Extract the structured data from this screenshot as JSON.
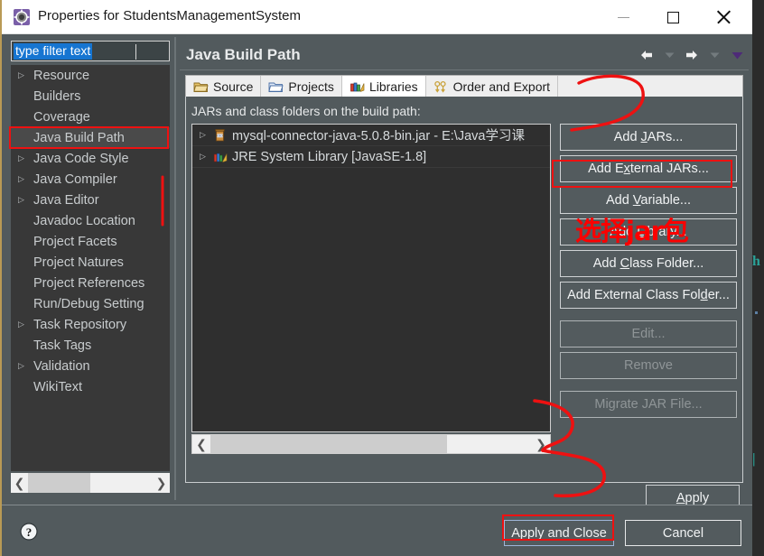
{
  "window": {
    "title": "Properties for StudentsManagementSystem",
    "app_icon": "eclipse-gear-icon",
    "minimize_label": "Minimize",
    "maximize_label": "Maximize",
    "close_label": "Close"
  },
  "filter": {
    "value": "type filter text",
    "placeholder": "type filter text"
  },
  "sidebar": {
    "items": [
      {
        "label": "Resource",
        "expandable": true,
        "selected": false
      },
      {
        "label": "Builders",
        "expandable": false,
        "selected": false
      },
      {
        "label": "Coverage",
        "expandable": false,
        "selected": false
      },
      {
        "label": "Java Build Path",
        "expandable": false,
        "selected": true
      },
      {
        "label": "Java Code Style",
        "expandable": true,
        "selected": false
      },
      {
        "label": "Java Compiler",
        "expandable": true,
        "selected": false
      },
      {
        "label": "Java Editor",
        "expandable": true,
        "selected": false
      },
      {
        "label": "Javadoc Location",
        "expandable": false,
        "selected": false
      },
      {
        "label": "Project Facets",
        "expandable": false,
        "selected": false
      },
      {
        "label": "Project Natures",
        "expandable": false,
        "selected": false
      },
      {
        "label": "Project References",
        "expandable": false,
        "selected": false
      },
      {
        "label": "Run/Debug Setting",
        "expandable": false,
        "selected": false
      },
      {
        "label": "Task Repository",
        "expandable": true,
        "selected": false
      },
      {
        "label": "Task Tags",
        "expandable": false,
        "selected": false
      },
      {
        "label": "Validation",
        "expandable": true,
        "selected": false
      },
      {
        "label": "WikiText",
        "expandable": false,
        "selected": false
      }
    ],
    "scroll_left_icon": "chevron-left-icon",
    "scroll_right_icon": "chevron-right-icon"
  },
  "page": {
    "title": "Java Build Path",
    "nav": {
      "back_icon": "arrow-left-icon",
      "back_menu_icon": "chevron-down-icon",
      "forward_icon": "arrow-right-icon",
      "forward_menu_icon": "chevron-down-icon",
      "view_menu_icon": "triangle-down-icon"
    }
  },
  "tabs": [
    {
      "label": "Source",
      "icon": "source-folder-icon",
      "active": false
    },
    {
      "label": "Projects",
      "icon": "project-folder-icon",
      "active": false
    },
    {
      "label": "Libraries",
      "icon": "books-icon",
      "active": true
    },
    {
      "label": "Order and Export",
      "icon": "order-export-icon",
      "active": false
    }
  ],
  "libraries": {
    "list_label": "JARs and class folders on the build path:",
    "entries": [
      {
        "label": "mysql-connector-java-5.0.8-bin.jar - E:\\Java学习课",
        "icon": "jar-icon",
        "expandable": true
      },
      {
        "label": "JRE System Library [JavaSE-1.8]",
        "icon": "library-icon",
        "expandable": true
      }
    ],
    "hscroll": {
      "left_icon": "chevron-left-icon",
      "right_icon": "chevron-right-icon"
    },
    "buttons": [
      {
        "label": "Add JARs...",
        "mnemonic": "J",
        "enabled": true
      },
      {
        "label": "Add External JARs...",
        "mnemonic": "x",
        "enabled": true
      },
      {
        "label": "Add Variable...",
        "mnemonic": "V",
        "enabled": true
      },
      {
        "label": "Add Library...",
        "mnemonic": "L",
        "enabled": true
      },
      {
        "label": "Add Class Folder...",
        "mnemonic": "C",
        "enabled": true
      },
      {
        "label": "Add External Class Folder...",
        "mnemonic": "d",
        "enabled": true
      },
      {
        "label": "Edit...",
        "mnemonic": "",
        "enabled": false
      },
      {
        "label": "Remove",
        "mnemonic": "",
        "enabled": false
      },
      {
        "label": "Migrate JAR File...",
        "mnemonic": "",
        "enabled": false
      }
    ],
    "apply_label": "Apply",
    "apply_mnemonic": "A"
  },
  "footer": {
    "help_icon": "help-question-icon",
    "apply_and_close_label": "Apply and Close",
    "cancel_label": "Cancel"
  },
  "annotations": {
    "note_text": "选择jar包",
    "color": "#fb0000",
    "highlight_sidebar_item": "Java Build Path",
    "highlight_button": "Add External JARs...",
    "highlight_footer_button": "Apply and Close"
  },
  "background_editor": {
    "visible_glyph_1": "h",
    "visible_glyph_2": "|"
  }
}
